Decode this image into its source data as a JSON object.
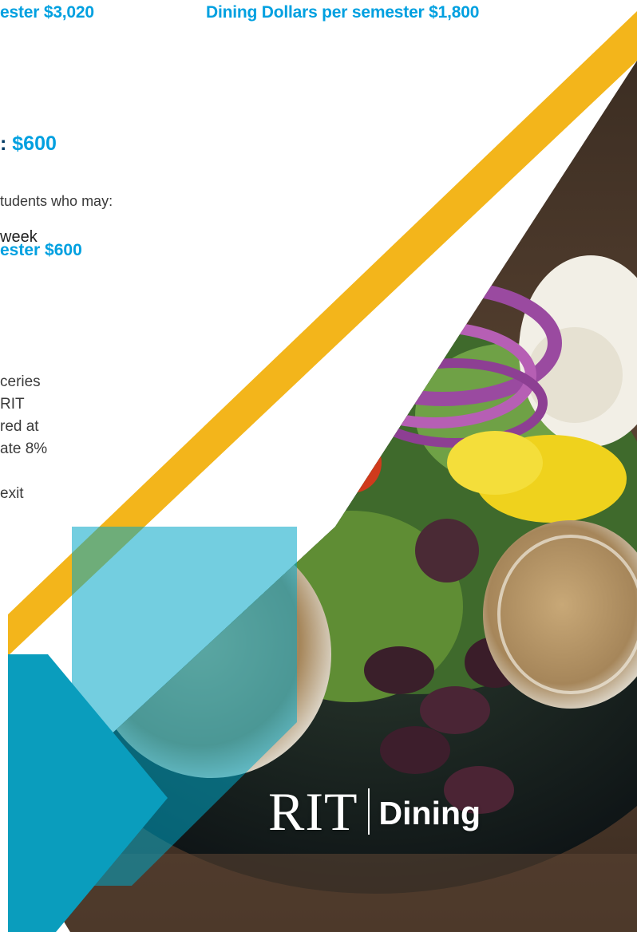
{
  "header": {
    "plan_left_text": "ester $3,020",
    "plan_right_text": "Dining Dollars per semester $1,800"
  },
  "plan": {
    "heading_prefix": ": ",
    "heading_amount": "$600",
    "intro_text": "tudents who may:",
    "bullet_text": "week",
    "semester_text": "ester $600"
  },
  "details": {
    "lines": [
      "ceries",
      "RIT",
      "red at",
      "ate 8%",
      "",
      "exit"
    ]
  },
  "logo": {
    "rit_text": "RIT",
    "dining_text": "Dining"
  },
  "colors": {
    "accent_blue": "#00a0e0",
    "navy": "#003a64",
    "gold": "#f3b51b",
    "teal": "#00a6c6",
    "white": "#ffffff"
  },
  "icons": [
    "rit-dining-logo"
  ]
}
